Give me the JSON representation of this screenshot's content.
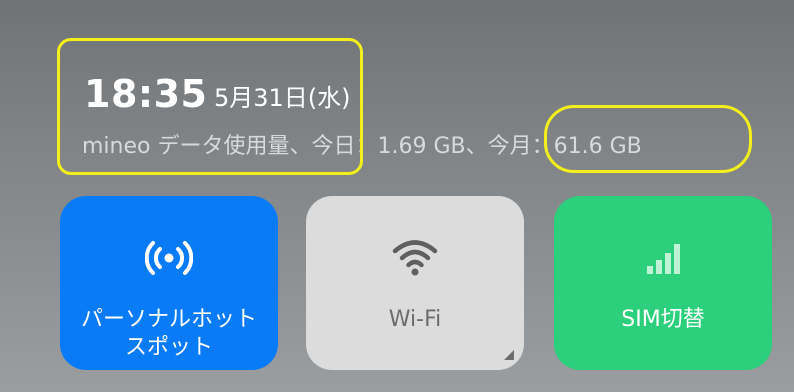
{
  "status": {
    "time": "18:35",
    "date": "5月31日(水)",
    "usage_prefix": "mineo データ使用量、今日：1.69 GB、",
    "usage_month": "今月：61.6 GB"
  },
  "colors": {
    "highlight": "#f2ef1b",
    "hotspot_tile": "#0a7bf6",
    "wifi_tile": "#dcdcdc",
    "sim_tile": "#2ccf7c"
  },
  "tiles": [
    {
      "icon": "hotspot-icon",
      "label_line1": "パーソナルホット",
      "label_line2": "スポット",
      "active": true
    },
    {
      "icon": "wifi-icon",
      "label": "Wi-Fi",
      "active": false
    },
    {
      "icon": "signal-bars-icon",
      "label": "SIM切替",
      "active": true
    }
  ]
}
